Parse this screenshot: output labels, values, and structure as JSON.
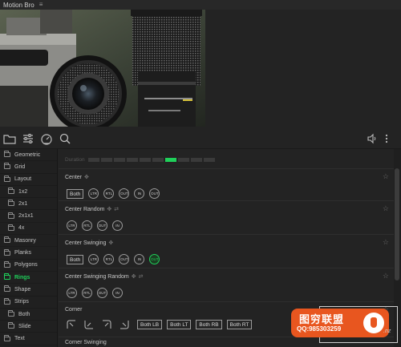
{
  "app": {
    "title": "Motion Bro",
    "menu_icon": "hamburger-icon"
  },
  "preview": {
    "alt": "camera-and-lens-thumbnail"
  },
  "toolbar": {
    "left_icons": [
      "folder-icon",
      "sliders-icon",
      "speedometer-icon",
      "search-icon"
    ],
    "right_icons": [
      "volume-icon",
      "more-vertical-icon"
    ]
  },
  "sidebar": {
    "items": [
      {
        "label": "Geometric",
        "level": 0,
        "active": false
      },
      {
        "label": "Grid",
        "level": 0,
        "active": false
      },
      {
        "label": "Layout",
        "level": 0,
        "active": false
      },
      {
        "label": "1x2",
        "level": 1,
        "active": false
      },
      {
        "label": "2x1",
        "level": 1,
        "active": false
      },
      {
        "label": "2x1x1",
        "level": 1,
        "active": false
      },
      {
        "label": "4x",
        "level": 1,
        "active": false
      },
      {
        "label": "Masonry",
        "level": 0,
        "active": false
      },
      {
        "label": "Planks",
        "level": 0,
        "active": false
      },
      {
        "label": "Polygons",
        "level": 0,
        "active": false
      },
      {
        "label": "Rings",
        "level": 0,
        "active": true
      },
      {
        "label": "Shape",
        "level": 0,
        "active": false
      },
      {
        "label": "Strips",
        "level": 0,
        "active": false
      },
      {
        "label": "Both",
        "level": 1,
        "active": false
      },
      {
        "label": "Slide",
        "level": 1,
        "active": false
      },
      {
        "label": "Text",
        "level": 0,
        "active": false
      }
    ]
  },
  "main": {
    "duration": {
      "label": "Duration",
      "segments": 10,
      "active_index": 6
    },
    "sections": [
      {
        "title": "Center",
        "both": "Both",
        "circles": [
          "LTR",
          "RTL",
          "OUT",
          "IN",
          "OUT"
        ],
        "active_circle": -1,
        "has_both": true,
        "extra_icon": false
      },
      {
        "title": "Center Random",
        "both": "",
        "circles": [
          "LTR",
          "RTL",
          "OUT",
          "IN"
        ],
        "active_circle": -1,
        "has_both": false,
        "extra_icon": true
      },
      {
        "title": "Center Swinging",
        "both": "Both",
        "circles": [
          "LTR",
          "RTL",
          "OUT",
          "IN",
          "OUT"
        ],
        "active_circle": 4,
        "has_both": true,
        "extra_icon": false
      },
      {
        "title": "Center Swinging Random",
        "both": "",
        "circles": [
          "LTR",
          "RTL",
          "OUT",
          "IN"
        ],
        "active_circle": -1,
        "has_both": false,
        "extra_icon": true
      }
    ],
    "corner": {
      "title": "Corner",
      "buttons": [
        "Both LB",
        "Both LT",
        "Both RB",
        "Both RT"
      ]
    },
    "corner_swinging": {
      "title": "Corner Swinging"
    }
  },
  "watermark": {
    "line1": "图穷联盟",
    "line2": "QQ:985303259",
    "suffix": ".nz"
  }
}
